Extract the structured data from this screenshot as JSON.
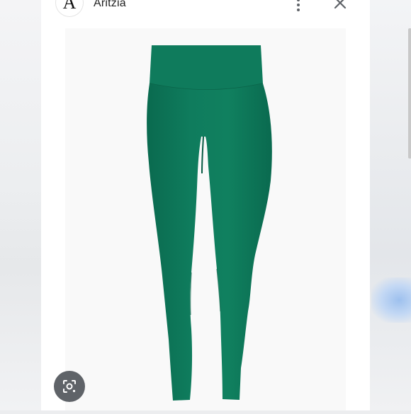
{
  "header": {
    "logo_letter": "A",
    "site_name": "Aritzia"
  },
  "icons": {
    "more": "more-vertical-icon",
    "close": "close-icon",
    "lens": "lens-search-icon",
    "product": "green-leggings-image"
  },
  "colors": {
    "leggings": "#0e7a5c",
    "leggings_shadow": "#075a43",
    "panel": "#ffffff",
    "lens_button": "#5f6368"
  }
}
